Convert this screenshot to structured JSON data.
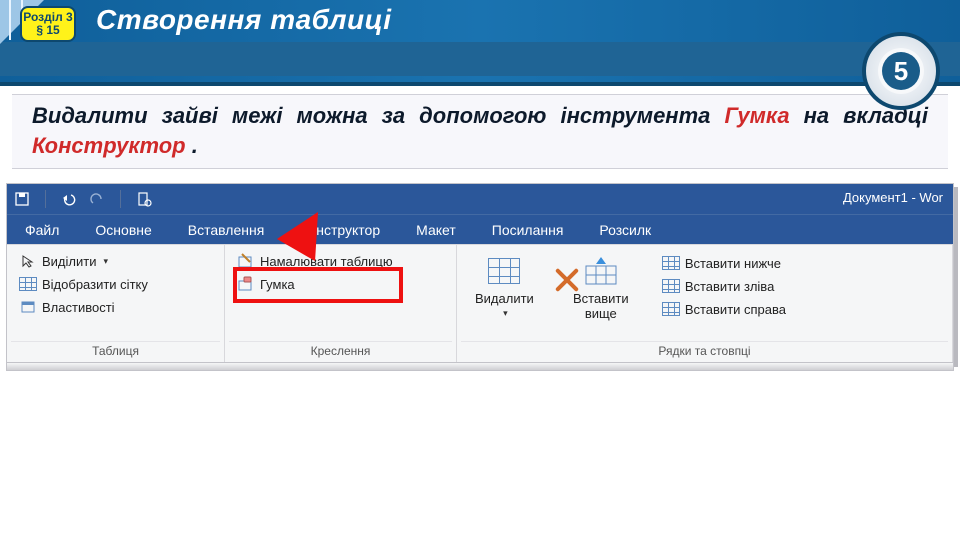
{
  "header": {
    "section_line1": "Розділ 3",
    "section_line2": "§ 15",
    "title": "Створення таблиці",
    "grade_number": "5"
  },
  "explanation": {
    "t1": "Видалити зайві межі можна за допомогою інструмента ",
    "hl1": "Гумка",
    "t2": " на вкладці ",
    "hl2": "Конструктор",
    "t3": "."
  },
  "word": {
    "doc_title": "Документ1 - Wor",
    "tabs": [
      "Файл",
      "Основне",
      "Вставлення",
      "Конструктор",
      "Макет",
      "Посилання",
      "Розсилк"
    ],
    "group_tablitsya": {
      "label": "Таблиця",
      "select": "Виділити",
      "show_grid": "Відобразити сітку",
      "properties": "Властивості"
    },
    "group_kreslennya": {
      "label": "Креслення",
      "draw_table": "Намалювати таблицю",
      "eraser": "Гумка"
    },
    "group_rows": {
      "label": "Рядки та стовпці",
      "delete": "Видалити",
      "insert_above": "Вставити вище",
      "insert_below": "Вставити нижче",
      "insert_left": "Вставити зліва",
      "insert_right": "Вставити справа"
    }
  }
}
